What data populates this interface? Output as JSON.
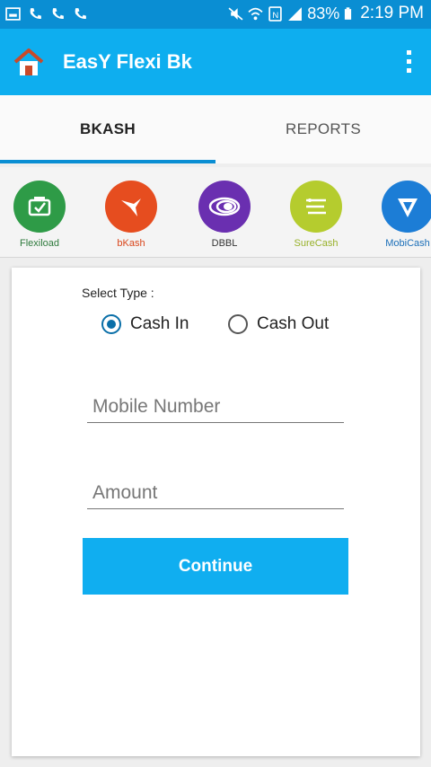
{
  "status_bar": {
    "battery": "83%",
    "time": "2:19 PM",
    "left_icons": [
      "gallery-icon",
      "missed-call-icon",
      "missed-call-icon",
      "missed-call-icon"
    ],
    "right_icons": [
      "mute-icon",
      "wifi-icon",
      "nfc-icon",
      "signal-icon",
      "battery-icon"
    ]
  },
  "app_bar": {
    "title": "EasY Flexi Bk",
    "icon": "home-icon",
    "menu_icon": "overflow-menu-icon",
    "color": "#0eaeef"
  },
  "tabs": [
    {
      "label": "BKASH",
      "active": true
    },
    {
      "label": "REPORTS",
      "active": false
    }
  ],
  "services": [
    {
      "label": "Flexiload",
      "color": "#2e9b47",
      "label_color": "#2e7a3c",
      "icon": "flexiload-icon"
    },
    {
      "label": "bKash",
      "color": "#e64d1f",
      "label_color": "#d9461b",
      "icon": "bkash-bird-icon"
    },
    {
      "label": "DBBL",
      "color": "#6a2fb0",
      "label_color": "#333333",
      "icon": "dbbl-logo-icon"
    },
    {
      "label": "SureCash",
      "color": "#b5cc2e",
      "label_color": "#98b12a",
      "icon": "surecash-logo-icon"
    },
    {
      "label": "MobiCash",
      "color": "#1c7dd6",
      "label_color": "#1c6fb8",
      "icon": "mobicash-logo-icon"
    }
  ],
  "form": {
    "select_type_label": "Select Type :",
    "options": [
      {
        "label": "Cash In",
        "checked": true
      },
      {
        "label": "Cash Out",
        "checked": false
      }
    ],
    "mobile_placeholder": "Mobile Number",
    "mobile_value": "",
    "amount_placeholder": "Amount",
    "amount_value": "",
    "continue_label": "Continue",
    "accent": "#10aef0"
  }
}
